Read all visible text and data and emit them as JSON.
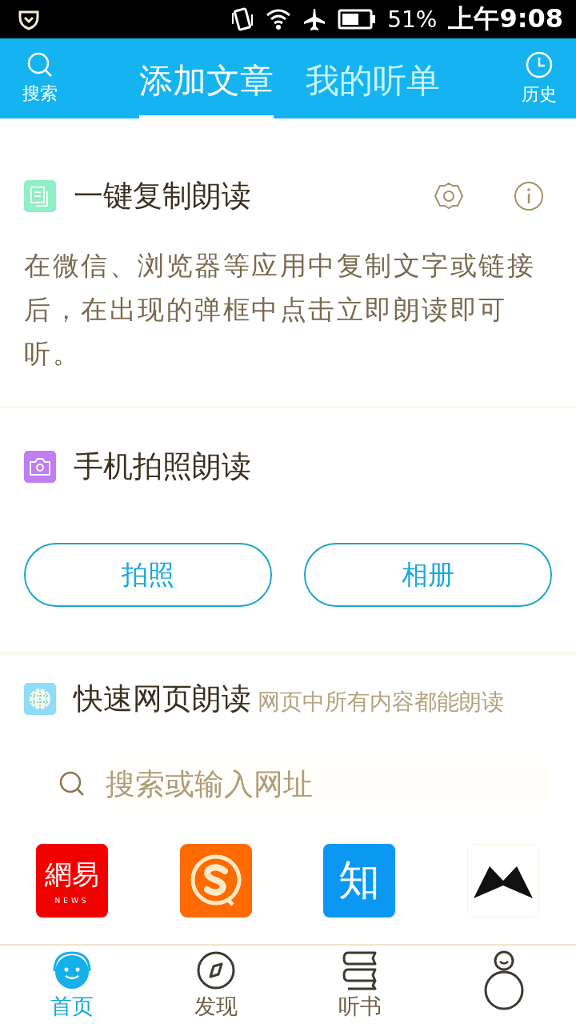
{
  "status_bar": {
    "battery": "51%",
    "time": "上午9:08"
  },
  "header": {
    "left": {
      "label": "搜索"
    },
    "right": {
      "label": "历史"
    },
    "tabs": [
      {
        "label": "添加文章",
        "selected": true
      },
      {
        "label": "我的听单",
        "selected": false
      }
    ]
  },
  "copy_read": {
    "title": "一键复制朗读",
    "description": "在微信、浏览器等应用中复制文字或链接后，在出现的弹框中点击立即朗读即可听。"
  },
  "photo_read": {
    "title": "手机拍照朗读",
    "buttons": [
      "拍照",
      "相册"
    ]
  },
  "web_read": {
    "title": "快速网页朗读",
    "subtitle": "网页中所有内容都能朗读",
    "search": {
      "placeholder": "搜索或输入网址"
    },
    "sites": [
      {
        "kind": "netease",
        "logo_text": "網易",
        "logo_sub": "NEWS"
      },
      {
        "kind": "sogou"
      },
      {
        "kind": "zhihu",
        "logo_text": "知"
      },
      {
        "kind": "bow"
      }
    ]
  },
  "bottom_nav": [
    {
      "kind": "home",
      "label": "首页",
      "selected": true
    },
    {
      "kind": "discover",
      "label": "发现",
      "selected": false
    },
    {
      "kind": "books",
      "label": "听书",
      "selected": false
    },
    {
      "kind": "account",
      "selected": false
    }
  ]
}
